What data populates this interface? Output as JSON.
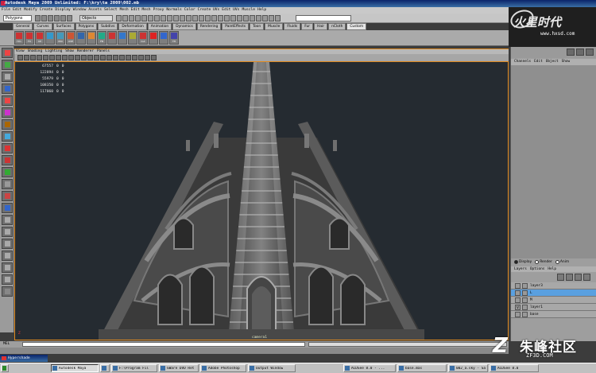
{
  "window": {
    "title": "Autodesk Maya 2009 Unlimited: F:\\kry\\ta 2009\\002.mb"
  },
  "menubar": [
    "File",
    "Edit",
    "Modify",
    "Create",
    "Display",
    "Window",
    "Assets",
    "Select",
    "Mesh",
    "Edit Mesh",
    "Proxy",
    "Normals",
    "Color",
    "Create UVs",
    "Edit UVs",
    "Muscle",
    "Help"
  ],
  "statusline": {
    "mode": "Polygons",
    "object_field": "Objects"
  },
  "shelf": {
    "tabs": [
      "General",
      "Curves",
      "Surfaces",
      "Polygons",
      "Subdivs",
      "Deformation",
      "Animation",
      "Dynamics",
      "Rendering",
      "PaintEffects",
      "Toon",
      "Muscle",
      "Fluids",
      "Fur",
      "Hair",
      "nCloth",
      "Custom"
    ],
    "active_tab": "Custom",
    "buttons": [
      "Hm",
      "FX",
      "CP",
      "",
      "Mdl",
      "UVE",
      "",
      "",
      "FB",
      "",
      "",
      "",
      "Cut",
      "",
      "",
      "TH"
    ]
  },
  "logo": {
    "brand": "火星时代",
    "url": "www.hxsd.com"
  },
  "panel": {
    "menu": [
      "View",
      "Shading",
      "Lighting",
      "Show",
      "Renderer",
      "Panels"
    ],
    "camera": "camera1"
  },
  "stats": [
    {
      "a": "67557",
      "b": "0",
      "c": "0"
    },
    {
      "a": "122894",
      "b": "0",
      "c": "0"
    },
    {
      "a": "55979",
      "b": "0",
      "c": "0"
    },
    {
      "a": "108350",
      "b": "0",
      "c": "0"
    },
    {
      "a": "117060",
      "b": "0",
      "c": "0"
    }
  ],
  "channel_box": {
    "menu": [
      "Channels",
      "Edit",
      "Object",
      "Show"
    ]
  },
  "layer_editor": {
    "modes": [
      "Display",
      "Render",
      "Anim"
    ],
    "active_mode": "Display",
    "menu": [
      "Layers",
      "Options",
      "Help"
    ],
    "layers": [
      {
        "name": "layer3",
        "visible": "",
        "selected": false
      },
      {
        "name": "L",
        "visible": "",
        "selected": true
      },
      {
        "name": "M",
        "visible": "",
        "selected": false
      },
      {
        "name": "layer1",
        "visible": "V",
        "selected": false
      },
      {
        "name": "base",
        "visible": "",
        "selected": false
      }
    ]
  },
  "cmdline": {
    "label": "MEL"
  },
  "tooltip": {
    "title": "Hypershade"
  },
  "taskbar": [
    {
      "label": "Autodesk Maya",
      "active": true
    },
    {
      "label": "",
      "active": false
    },
    {
      "label": "F:\\Program Fil",
      "active": false
    },
    {
      "label": "GWare DVD Ret",
      "active": false
    },
    {
      "label": "Adobe Photoshop",
      "active": false
    },
    {
      "label": "Output Window",
      "active": false
    },
    {
      "label": "ACDSee 8.0 - ...",
      "active": false
    },
    {
      "label": "base.mas",
      "active": false
    },
    {
      "label": "002_a.sky - Sa",
      "active": false
    },
    {
      "label": "ACDSee 8.0",
      "active": false
    }
  ],
  "watermark": {
    "text": "朱峰社区",
    "url": "ZF3D.COM"
  },
  "colors": {
    "viewport_bg": "#252b31",
    "active_border": "#e08a1f",
    "selected_layer": "#5aa0e0"
  }
}
